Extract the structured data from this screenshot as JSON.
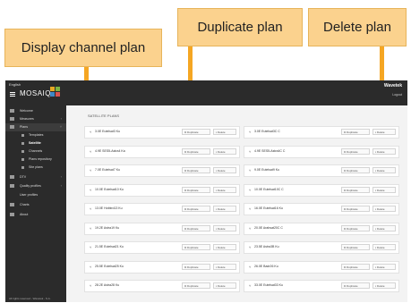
{
  "callouts": {
    "display": "Display channel plan",
    "duplicate": "Duplicate plan",
    "delete": "Delete plan"
  },
  "header": {
    "language": "English",
    "brand": "MOSAIQ",
    "partner": "Wavetek",
    "logout": "Logout"
  },
  "sidebar": {
    "items": [
      {
        "label": "Welcome",
        "icon": "home-icon"
      },
      {
        "label": "Measures",
        "icon": "chart-icon"
      },
      {
        "label": "Plans",
        "icon": "list-icon"
      },
      {
        "label": "Templates",
        "icon": "template-icon"
      },
      {
        "label": "Satellite",
        "icon": "satellite-icon"
      },
      {
        "label": "Channels",
        "icon": "channel-icon"
      },
      {
        "label": "Plans repository",
        "icon": "repo-icon"
      },
      {
        "label": "Site plans",
        "icon": "site-icon"
      },
      {
        "label": "DTV",
        "icon": "tv-icon"
      },
      {
        "label": "Quality profiles",
        "icon": "profile-icon"
      },
      {
        "label": "User profiles",
        "icon": "user-icon"
      },
      {
        "label": "Charts",
        "icon": "charts-icon"
      },
      {
        "label": "About",
        "icon": "info-icon"
      }
    ],
    "footer": "All rights reserved - Wavetek - S.A."
  },
  "main": {
    "section_title": "SATELLITE PLANS",
    "duplicate_label": "Duplicate",
    "delete_label": "Delete",
    "plans_left": [
      "3.0E Eutelsat3 Ku",
      "4.9E SES5-Astra4 Ka",
      "7.0E Eutelsat7 Ku",
      "10.0E Eutelsat10 Ku",
      "13.0E Hotbird13 Ku",
      "19.2E Astra19 Ku",
      "21.5E Eutelsat21 Ku",
      "25.5E Eutelsat25 Ku",
      "28.2E Astra28 Ku"
    ],
    "plans_right": [
      "3.0E Eutelsat3C C",
      "4.9E SES5-Astra4C C",
      "9.0E Eutelsat9 Ku",
      "10.0E Eutelsat10C C",
      "16.0E Eutelsat16 Ku",
      "20.0E Arabsat20C C",
      "23.5E Astra3B Ku",
      "26.0E Badr26 Ku",
      "33.0E Eutelsat33 Ku"
    ]
  }
}
